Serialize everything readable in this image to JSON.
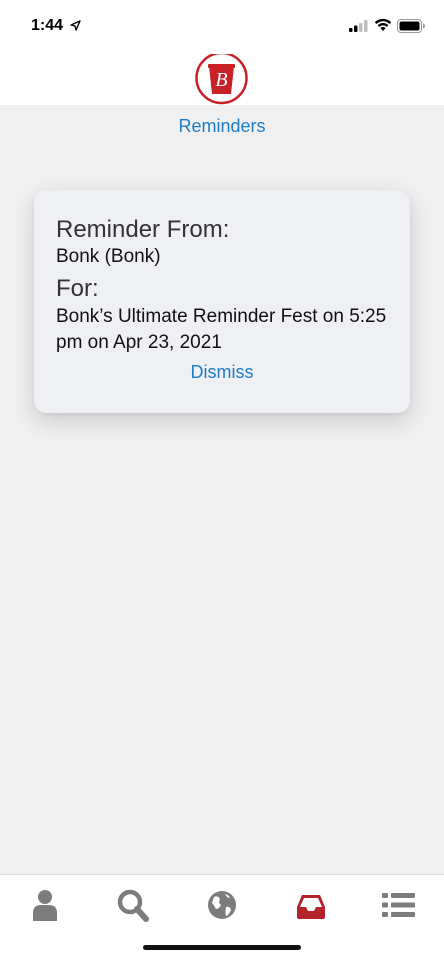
{
  "status_bar": {
    "time": "1:44",
    "icons": [
      "location-arrow-icon",
      "cellular-signal-icon",
      "wifi-icon",
      "battery-icon"
    ]
  },
  "header": {
    "logo": {
      "letter": "B",
      "icon": "bucket-logo-icon",
      "color": "#c82127"
    }
  },
  "page": {
    "title": "Reminders"
  },
  "reminder": {
    "from_heading": "Reminder From:",
    "from_value": "Bonk  (Bonk)",
    "for_heading": "For:",
    "event_text": "Bonk’s Ultimate Reminder Fest on 5:25 pm on Apr 23, 2021",
    "dismiss_label": "Dismiss"
  },
  "tab_bar": {
    "tabs": [
      {
        "name": "profile",
        "icon": "person-icon",
        "active": false
      },
      {
        "name": "search",
        "icon": "search-icon",
        "active": false
      },
      {
        "name": "globe",
        "icon": "globe-icon",
        "active": false
      },
      {
        "name": "inbox",
        "icon": "inbox-icon",
        "active": true
      },
      {
        "name": "list",
        "icon": "list-icon",
        "active": false
      }
    ],
    "active_color": "#b3232b",
    "inactive_color": "#7c7c7c"
  },
  "colors": {
    "accent": "#1f7cc4",
    "background": "#f0f0f1",
    "card": "#eef0f3"
  }
}
